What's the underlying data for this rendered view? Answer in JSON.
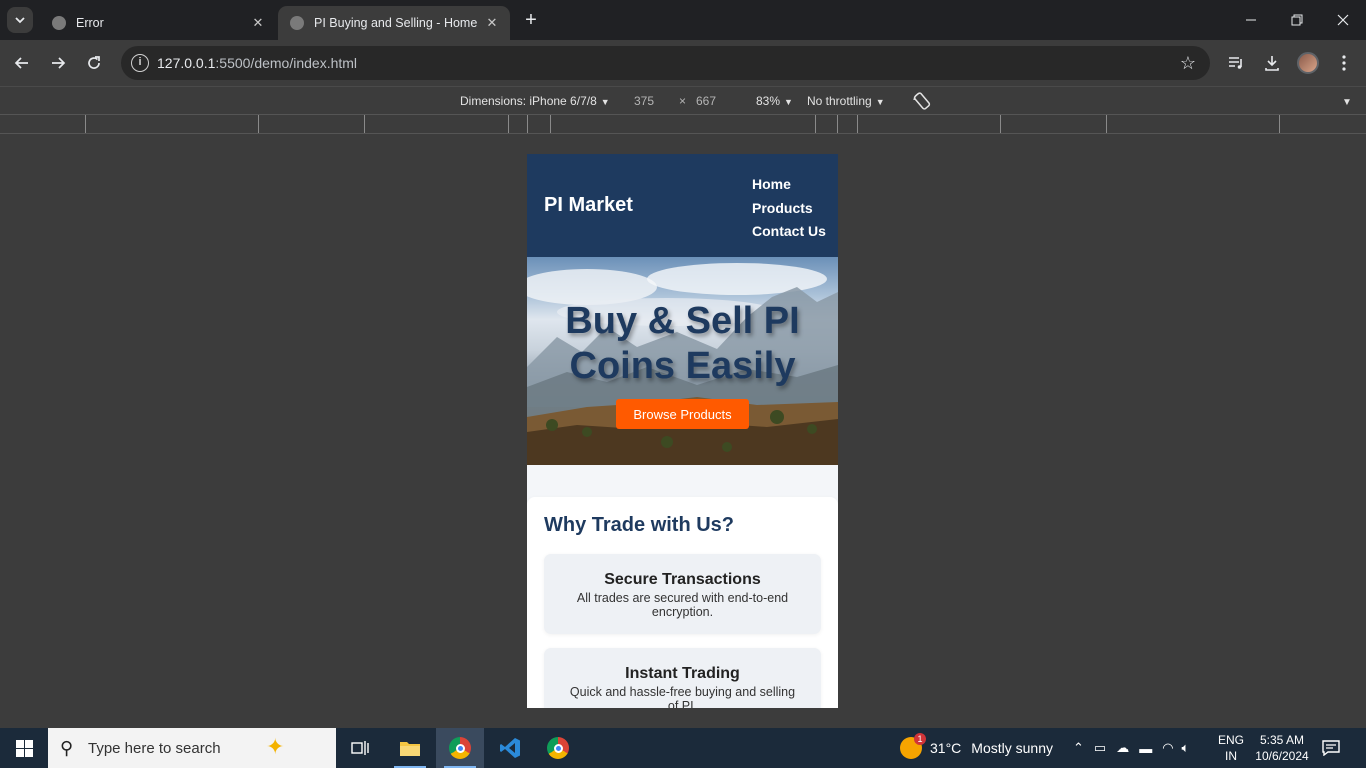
{
  "browser": {
    "tabs": [
      {
        "title": "Error"
      },
      {
        "title": "PI Buying and Selling - Home"
      }
    ],
    "url_host": "127.0.0.1",
    "url_path": ":5500/demo/index.html"
  },
  "devtools": {
    "dimensions_label": "Dimensions: iPhone 6/7/8",
    "width": "375",
    "times": "×",
    "height": "667",
    "zoom": "83%",
    "throttling": "No throttling"
  },
  "site": {
    "logo": "PI Market",
    "nav": [
      "Home",
      "Products",
      "Contact Us"
    ],
    "hero_title": "Buy & Sell PI Coins Easily",
    "hero_button": "Browse Products",
    "why_title": "Why Trade with Us?",
    "features": [
      {
        "title": "Secure Transactions",
        "desc": "All trades are secured with end-to-end encryption."
      },
      {
        "title": "Instant Trading",
        "desc": "Quick and hassle-free buying and selling of PI."
      }
    ]
  },
  "taskbar": {
    "search_placeholder": "Type here to search",
    "weather_temp": "31°C",
    "weather_desc": "Mostly sunny",
    "weather_badge": "1",
    "lang_top": "ENG",
    "lang_bottom": "IN",
    "time": "5:35 AM",
    "date": "10/6/2024"
  },
  "icons": {
    "tab_menu": "chevron-down-icon",
    "back": "arrow-left-icon",
    "forward": "arrow-right-icon",
    "reload": "reload-icon",
    "bookmark": "star-icon",
    "media": "media-control-icon",
    "download": "download-icon",
    "menu": "kebab-menu-icon",
    "rotate": "rotate-icon",
    "windows": "windows-logo-icon"
  }
}
